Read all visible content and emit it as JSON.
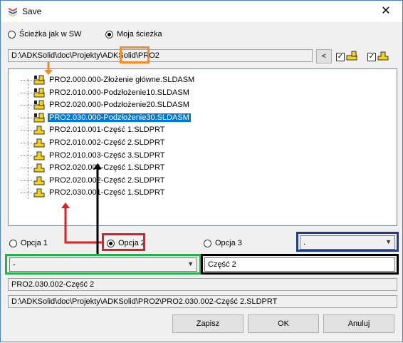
{
  "window": {
    "title": "Save",
    "close_glyph": "✕"
  },
  "path_mode": {
    "options": [
      {
        "label": "Ścieżka jak w SW",
        "selected": false
      },
      {
        "label": "Moja ścieżka",
        "selected": true
      }
    ]
  },
  "path": {
    "prefix": "D:\\ADKSolid\\doc\\Projekty\\ADKSolid\\",
    "highlighted": "PRO2",
    "back_label": "<"
  },
  "tree": {
    "items": [
      {
        "label": "PRO2.000.000-Złożenie główne.SLDASM",
        "type": "assembly",
        "selected": false
      },
      {
        "label": "PRO2.010.000-Podzłożenie10.SLDASM",
        "type": "assembly",
        "selected": false
      },
      {
        "label": "PRO2.020.000-Podzłożenie20.SLDASM",
        "type": "assembly",
        "selected": false
      },
      {
        "label": "PRO2.030.000-Podzłożenie30.SLDASM",
        "type": "assembly",
        "selected": true
      },
      {
        "label": "PRO2.010.001-Część 1.SLDPRT",
        "type": "part",
        "selected": false
      },
      {
        "label": "PRO2.010.002-Część 2.SLDPRT",
        "type": "part",
        "selected": false
      },
      {
        "label": "PRO2.010.003-Część 3.SLDPRT",
        "type": "part",
        "selected": false
      },
      {
        "label": "PRO2.020.001-Część 1.SLDPRT",
        "type": "part",
        "selected": false
      },
      {
        "label": "PRO2.020.002-Część 2.SLDPRT",
        "type": "part",
        "selected": false
      },
      {
        "label": "PRO2.030.001-Część 1.SLDPRT",
        "type": "part",
        "selected": false
      }
    ]
  },
  "options": {
    "items": [
      {
        "label": "Opcja 1",
        "selected": false
      },
      {
        "label": "Opcja 2",
        "selected": true
      },
      {
        "label": "Opcja 3",
        "selected": false
      }
    ],
    "option3_combo_value": "."
  },
  "name_row": {
    "prefix_combo_value": "-",
    "name_value": "Część 2"
  },
  "result": {
    "filename": "PRO2.030.002-Część 2",
    "full_path": "D:\\ADKSolid\\doc\\Projekty\\ADKSolid\\PRO2\\PRO2.030.002-Część 2.SLDPRT"
  },
  "buttons": {
    "save": "Zapisz",
    "ok": "OK",
    "cancel": "Anuluj"
  },
  "colors": {
    "selection": "#0078d7",
    "orange_frame": "#f28c28",
    "red_frame": "#e02020",
    "green_frame": "#22b14c",
    "navy_frame": "#1f3c88",
    "black_frame": "#000000"
  }
}
